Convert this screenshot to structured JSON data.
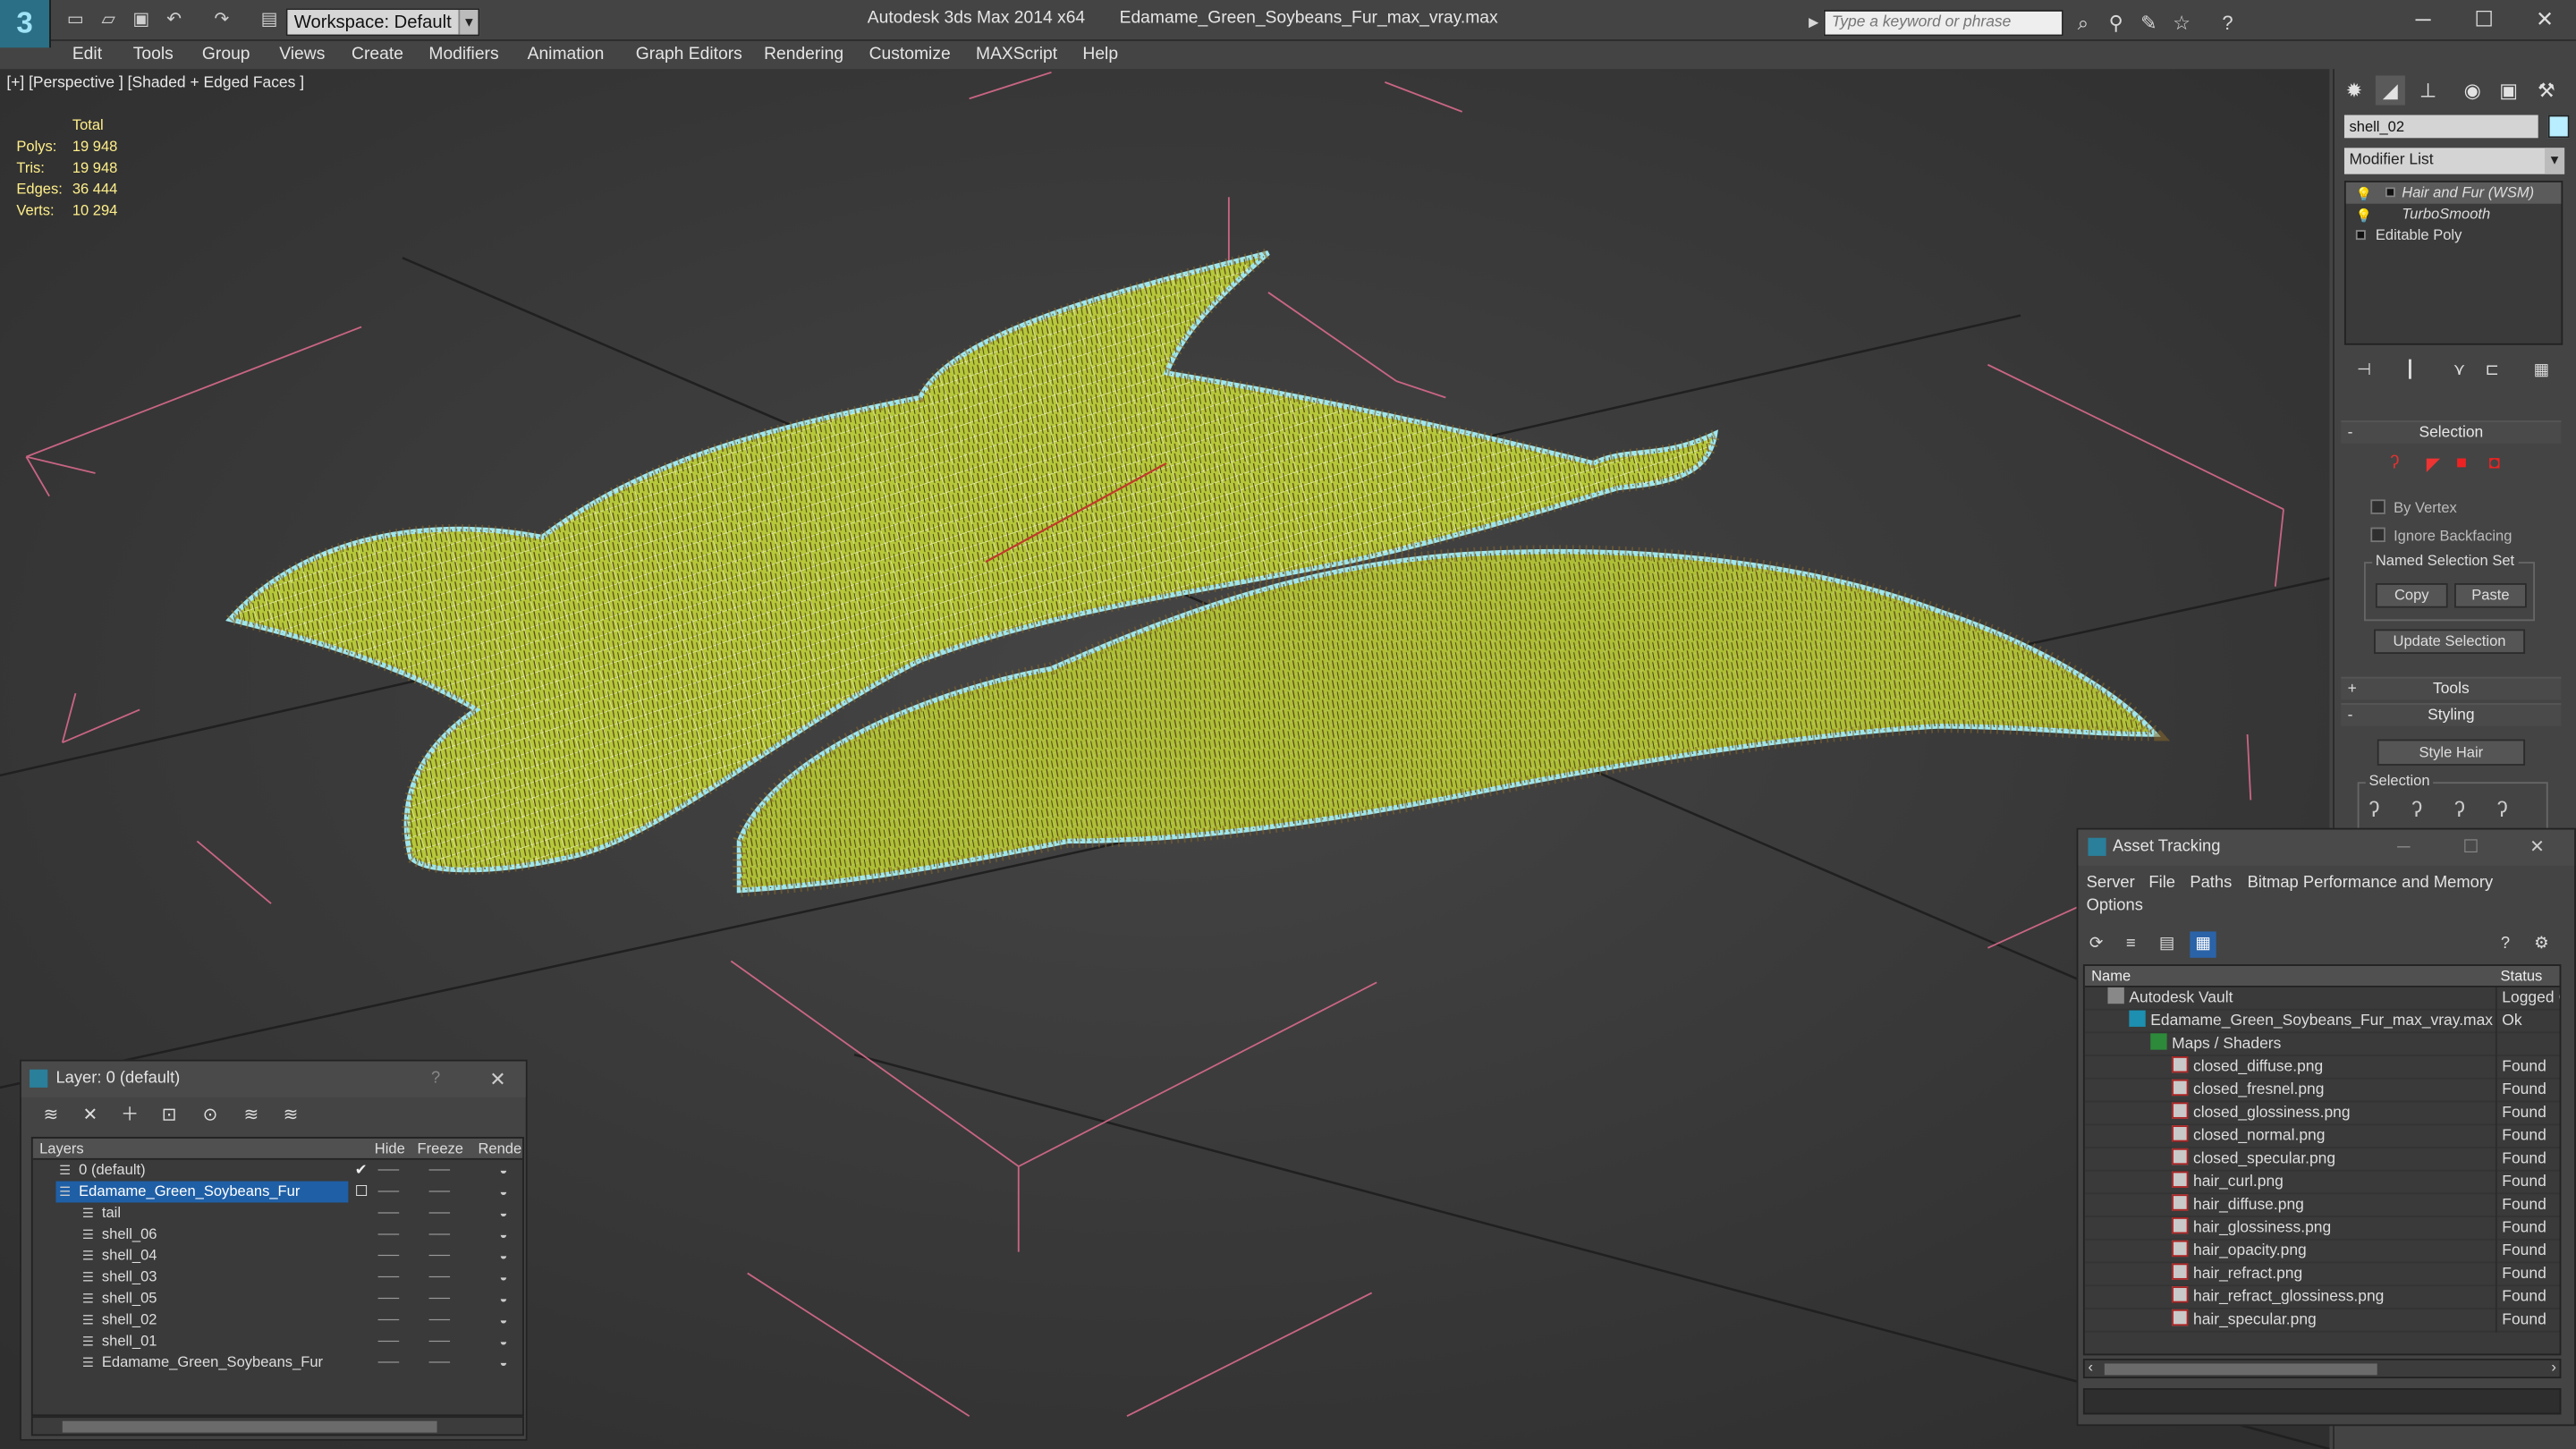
{
  "window": {
    "app_title": "Autodesk 3ds Max  2014 x64",
    "file_title": "Edamame_Green_Soybeans_Fur_max_vray.max",
    "workspace_label": "Workspace: Default",
    "search_placeholder": "Type a keyword or phrase",
    "minimize": "─",
    "maximize": "☐",
    "close": "✕"
  },
  "menubar": [
    "Edit",
    "Tools",
    "Group",
    "Views",
    "Create",
    "Modifiers",
    "Animation",
    "Graph Editors",
    "Rendering",
    "Customize",
    "MAXScript",
    "Help"
  ],
  "viewport": {
    "label": "[+] [Perspective ] [Shaded + Edged Faces ]",
    "stats": {
      "header": "Total",
      "rows": [
        {
          "label": "Polys:",
          "value": "19 948"
        },
        {
          "label": "Tris:",
          "value": "19 948"
        },
        {
          "label": "Edges:",
          "value": "36 444"
        },
        {
          "label": "Verts:",
          "value": "10 294"
        }
      ]
    }
  },
  "command_panel": {
    "object_name": "shell_02",
    "modifier_list_label": "Modifier List",
    "stack": [
      {
        "name": "Hair and Fur (WSM)",
        "selected": true
      },
      {
        "name": "TurboSmooth",
        "selected": false
      },
      {
        "name": "Editable Poly",
        "selected": false
      }
    ],
    "selection_rollout": "Selection",
    "by_vertex": "By Vertex",
    "ignore_backfacing": "Ignore Backfacing",
    "named_selection_set": "Named Selection Set",
    "copy": "Copy",
    "paste": "Paste",
    "update_selection": "Update Selection",
    "tools_rollout": "Tools",
    "styling_rollout": "Styling",
    "style_hair": "Style Hair",
    "selection_group": "Selection",
    "collapsed_sign": "+",
    "expanded_sign": "-"
  },
  "layer_window": {
    "title": "Layer: 0 (default)",
    "help": "?",
    "close": "✕",
    "columns": {
      "layers": "Layers",
      "hide": "Hide",
      "freeze": "Freeze",
      "render": "Render"
    },
    "rows": [
      {
        "name": "0 (default)",
        "indent": 1,
        "check": "✔",
        "selected": false
      },
      {
        "name": "Edamame_Green_Soybeans_Fur",
        "indent": 1,
        "check": "☐",
        "selected": true
      },
      {
        "name": "tail",
        "indent": 2,
        "check": "",
        "selected": false
      },
      {
        "name": "shell_06",
        "indent": 2,
        "check": "",
        "selected": false
      },
      {
        "name": "shell_04",
        "indent": 2,
        "check": "",
        "selected": false
      },
      {
        "name": "shell_03",
        "indent": 2,
        "check": "",
        "selected": false
      },
      {
        "name": "shell_05",
        "indent": 2,
        "check": "",
        "selected": false
      },
      {
        "name": "shell_02",
        "indent": 2,
        "check": "",
        "selected": false
      },
      {
        "name": "shell_01",
        "indent": 2,
        "check": "",
        "selected": false
      },
      {
        "name": "Edamame_Green_Soybeans_Fur",
        "indent": 2,
        "check": "",
        "selected": false
      }
    ]
  },
  "asset_window": {
    "title": "Asset Tracking",
    "menu": [
      "Server",
      "File",
      "Paths",
      "Bitmap Performance and Memory",
      "Options"
    ],
    "columns": {
      "name": "Name",
      "status": "Status"
    },
    "rows": [
      {
        "name": "Autodesk Vault",
        "status": "Logged O",
        "icon": "vault",
        "indent": 0
      },
      {
        "name": "Edamame_Green_Soybeans_Fur_max_vray.max",
        "status": "Ok",
        "icon": "max",
        "indent": 1
      },
      {
        "name": "Maps / Shaders",
        "status": "",
        "icon": "maps",
        "indent": 2
      },
      {
        "name": "closed_diffuse.png",
        "status": "Found",
        "icon": "png",
        "indent": 3
      },
      {
        "name": "closed_fresnel.png",
        "status": "Found",
        "icon": "png",
        "indent": 3
      },
      {
        "name": "closed_glossiness.png",
        "status": "Found",
        "icon": "png",
        "indent": 3
      },
      {
        "name": "closed_normal.png",
        "status": "Found",
        "icon": "png",
        "indent": 3
      },
      {
        "name": "closed_specular.png",
        "status": "Found",
        "icon": "png",
        "indent": 3
      },
      {
        "name": "hair_curl.png",
        "status": "Found",
        "icon": "png",
        "indent": 3
      },
      {
        "name": "hair_diffuse.png",
        "status": "Found",
        "icon": "png",
        "indent": 3
      },
      {
        "name": "hair_glossiness.png",
        "status": "Found",
        "icon": "png",
        "indent": 3
      },
      {
        "name": "hair_opacity.png",
        "status": "Found",
        "icon": "png",
        "indent": 3
      },
      {
        "name": "hair_refract.png",
        "status": "Found",
        "icon": "png",
        "indent": 3
      },
      {
        "name": "hair_refract_glossiness.png",
        "status": "Found",
        "icon": "png",
        "indent": 3
      },
      {
        "name": "hair_specular.png",
        "status": "Found",
        "icon": "png",
        "indent": 3
      }
    ]
  },
  "colors": {
    "bean_fill": "#b6c83a",
    "bean_edge": "#9fe6ee",
    "fur": "#8a6a2a",
    "grid": "#1e1e1e",
    "box": "#d86a8c",
    "selection_blue": "#1f5fa6",
    "stats_yellow": "#ffef8a"
  }
}
